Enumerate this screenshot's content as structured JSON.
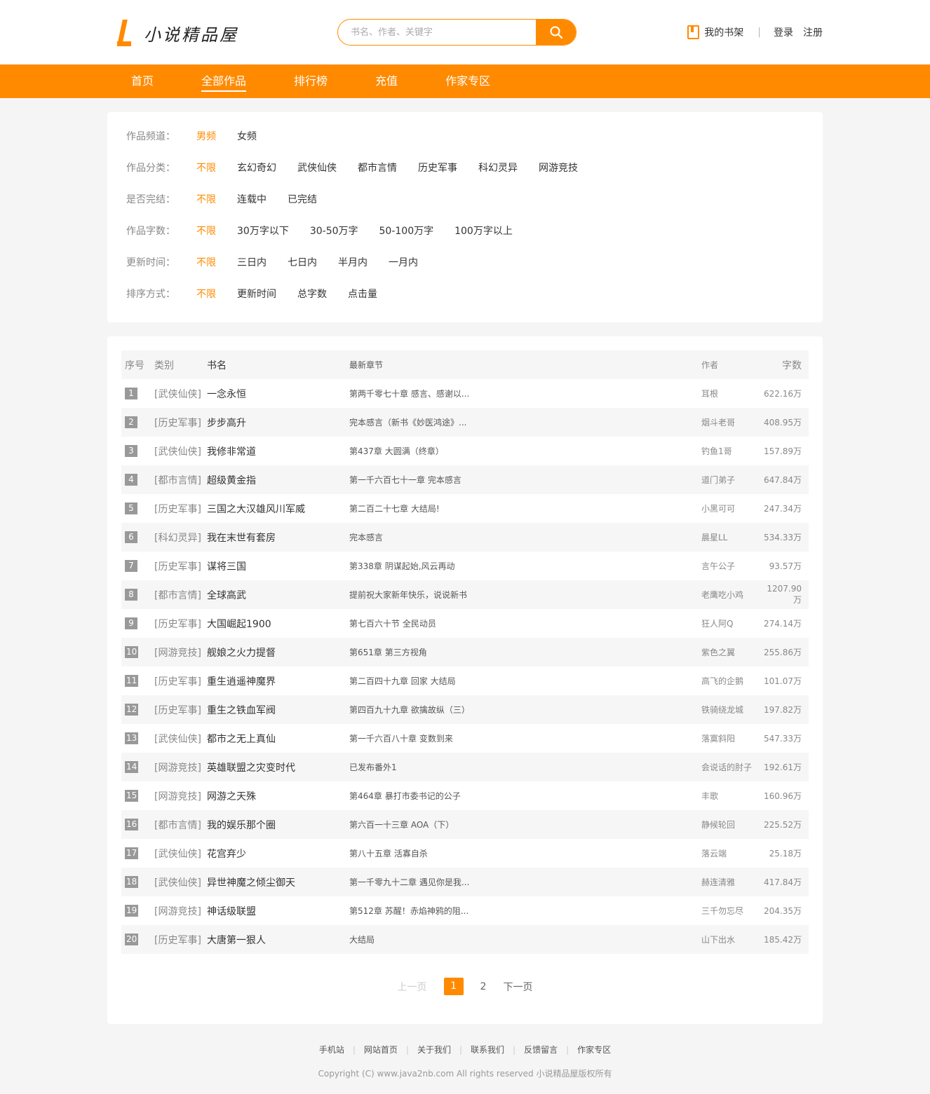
{
  "header": {
    "logo_text": "小说精品屋",
    "search_placeholder": "书名、作者、关键字",
    "shelf_label": "我的书架",
    "login": "登录",
    "register": "注册"
  },
  "nav": [
    "首页",
    "全部作品",
    "排行榜",
    "充值",
    "作家专区"
  ],
  "filters": [
    {
      "label": "作品频道：",
      "options": [
        "男频",
        "女频"
      ]
    },
    {
      "label": "作品分类：",
      "options": [
        "不限",
        "玄幻奇幻",
        "武侠仙侠",
        "都市言情",
        "历史军事",
        "科幻灵异",
        "网游竞技"
      ]
    },
    {
      "label": "是否完结：",
      "options": [
        "不限",
        "连载中",
        "已完结"
      ]
    },
    {
      "label": "作品字数：",
      "options": [
        "不限",
        "30万字以下",
        "30-50万字",
        "50-100万字",
        "100万字以上"
      ]
    },
    {
      "label": "更新时间：",
      "options": [
        "不限",
        "三日内",
        "七日内",
        "半月内",
        "一月内"
      ]
    },
    {
      "label": "排序方式：",
      "options": [
        "不限",
        "更新时间",
        "总字数",
        "点击量"
      ]
    }
  ],
  "table": {
    "headers": [
      "序号",
      "类别",
      "书名",
      "最新章节",
      "作者",
      "字数"
    ],
    "rows": [
      {
        "no": "1",
        "cat": "[武侠仙侠]",
        "name": "一念永恒",
        "chapter": "第两千零七十章 感言、感谢以...",
        "author": "耳根",
        "count": "622.16万"
      },
      {
        "no": "2",
        "cat": "[历史军事]",
        "name": "步步高升",
        "chapter": "完本感言（新书《妙医鸿途》...",
        "author": "烟斗老哥",
        "count": "408.95万"
      },
      {
        "no": "3",
        "cat": "[武侠仙侠]",
        "name": "我修非常道",
        "chapter": "第437章 大圆满（终章）",
        "author": "钓鱼1哥",
        "count": "157.89万"
      },
      {
        "no": "4",
        "cat": "[都市言情]",
        "name": "超级黄金指",
        "chapter": "第一千六百七十一章 完本感言",
        "author": "道门弟子",
        "count": "647.84万"
      },
      {
        "no": "5",
        "cat": "[历史军事]",
        "name": "三国之大汉雄风川军威",
        "chapter": "第二百二十七章 大结局!",
        "author": "小黑可可",
        "count": "247.34万"
      },
      {
        "no": "6",
        "cat": "[科幻灵异]",
        "name": "我在末世有套房",
        "chapter": "完本感言",
        "author": "晨星LL",
        "count": "534.33万"
      },
      {
        "no": "7",
        "cat": "[历史军事]",
        "name": "谋将三国",
        "chapter": "第338章 阴谋起始,风云再动",
        "author": "言午公子",
        "count": "93.57万"
      },
      {
        "no": "8",
        "cat": "[都市言情]",
        "name": "全球高武",
        "chapter": "提前祝大家新年快乐，说说新书",
        "author": "老鹰吃小鸡",
        "count": "1207.90万"
      },
      {
        "no": "9",
        "cat": "[历史军事]",
        "name": "大国崛起1900",
        "chapter": "第七百六十节 全民动员",
        "author": "狂人阿Q",
        "count": "274.14万"
      },
      {
        "no": "10",
        "cat": "[网游竞技]",
        "name": "舰娘之火力提督",
        "chapter": "第651章 第三方视角",
        "author": "紫色之翼",
        "count": "255.86万"
      },
      {
        "no": "11",
        "cat": "[历史军事]",
        "name": "重生逍遥神魔界",
        "chapter": "第二百四十九章 回家 大结局",
        "author": "高飞的企鹅",
        "count": "101.07万"
      },
      {
        "no": "12",
        "cat": "[历史军事]",
        "name": "重生之铁血军阀",
        "chapter": "第四百九十九章 欲擒故纵（三）",
        "author": "铁骑绕龙城",
        "count": "197.82万"
      },
      {
        "no": "13",
        "cat": "[武侠仙侠]",
        "name": "都市之无上真仙",
        "chapter": "第一千六百八十章 变数到来",
        "author": "落寞斜阳",
        "count": "547.33万"
      },
      {
        "no": "14",
        "cat": "[网游竞技]",
        "name": "英雄联盟之灾变时代",
        "chapter": "已发布番外1",
        "author": "会说话的肘子",
        "count": "192.61万"
      },
      {
        "no": "15",
        "cat": "[网游竞技]",
        "name": "网游之天殊",
        "chapter": "第464章 暴打市委书记的公子",
        "author": "丰歌",
        "count": "160.96万"
      },
      {
        "no": "16",
        "cat": "[都市言情]",
        "name": "我的娱乐那个圈",
        "chapter": "第六百一十三章 AOA（下）",
        "author": "静候轮回",
        "count": "225.52万"
      },
      {
        "no": "17",
        "cat": "[武侠仙侠]",
        "name": "花宫弃少",
        "chapter": "第八十五章 活寡自杀",
        "author": "落云端",
        "count": "25.18万"
      },
      {
        "no": "18",
        "cat": "[武侠仙侠]",
        "name": "异世神魔之倾尘御天",
        "chapter": "第一千零九十二章 遇见你是我...",
        "author": "赫连清雅",
        "count": "417.84万"
      },
      {
        "no": "19",
        "cat": "[网游竞技]",
        "name": "神话级联盟",
        "chapter": "第512章 苏醒！赤焰神鸦的阻...",
        "author": "三千勿忘尽",
        "count": "204.35万"
      },
      {
        "no": "20",
        "cat": "[历史军事]",
        "name": "大唐第一狠人",
        "chapter": "大结局",
        "author": "山下出水",
        "count": "185.42万"
      }
    ]
  },
  "pager": {
    "prev": "上一页",
    "pages": [
      "1",
      "2"
    ],
    "current": "1",
    "next": "下一页"
  },
  "footer": {
    "links": [
      "手机站",
      "网站首页",
      "关于我们",
      "联系我们",
      "反馈留言",
      "作家专区"
    ],
    "copyright": "Copyright (C) www.java2nb.com All rights reserved  小说精品屋版权所有"
  },
  "colors": {
    "accent": "#ff8a00",
    "background": "#f5f5f5"
  },
  "icons": {
    "search": "search-icon",
    "shelf": "bookshelf-icon",
    "logo": "logo-icon"
  }
}
